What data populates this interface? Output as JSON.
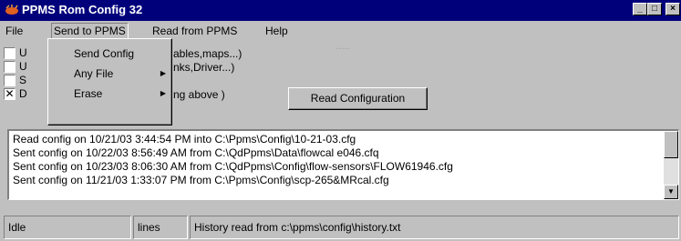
{
  "window": {
    "title": "PPMS Rom Config 32",
    "controls": [
      "minimize",
      "maximize",
      "close"
    ]
  },
  "menubar": {
    "items": [
      {
        "label": "File"
      },
      {
        "label": "Send to PPMS"
      },
      {
        "label": "Read from PPMS"
      },
      {
        "label": "Help"
      }
    ]
  },
  "dropdown": {
    "items": [
      {
        "label": "Send Config",
        "submenu": false
      },
      {
        "label": "Any File",
        "submenu": true
      },
      {
        "label": "Erase",
        "submenu": true
      }
    ]
  },
  "options": [
    {
      "prefix": "U",
      "label": "ables,maps...)",
      "checked": false
    },
    {
      "prefix": "U",
      "label": "nks,Driver...)",
      "checked": false
    },
    {
      "prefix": "S",
      "label": "",
      "checked": false
    },
    {
      "prefix": "D",
      "label": "ng above )",
      "checked": true
    }
  ],
  "faded_text": "‧‧‧‧‧",
  "read_button": {
    "label": "Read Configuration"
  },
  "log": {
    "lines": [
      "Read config on 10/21/03 3:44:54 PM into C:\\Ppms\\Config\\10-21-03.cfg",
      "Sent config on 10/22/03 8:56:49 AM from C:\\QdPpms\\Data\\flowcal e046.cfq",
      "Sent config on 10/23/03 8:06:30 AM from C:\\QdPpms\\Config\\flow-sensors\\FLOW61946.cfg",
      "Sent config on 11/21/03 1:33:07 PM from C:\\Ppms\\Config\\scp-265&MRcal.cfg"
    ]
  },
  "status": {
    "state": "Idle",
    "mode": "lines",
    "message": "History read from c:\\ppms\\config\\history.txt"
  }
}
